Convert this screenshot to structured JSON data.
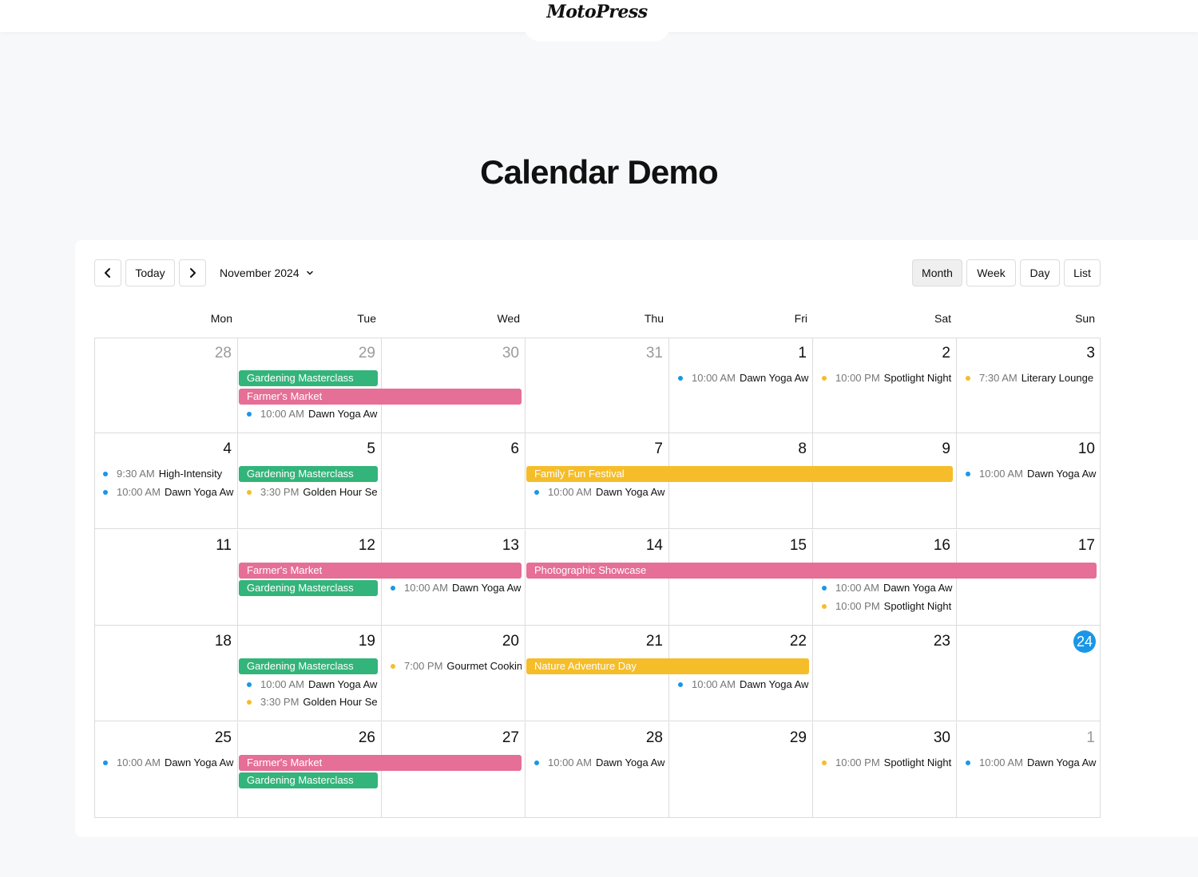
{
  "header": {
    "logo": "MotoPress"
  },
  "page": {
    "title": "Calendar Demo"
  },
  "toolbar": {
    "prev_icon": "chevron-left-icon",
    "today_label": "Today",
    "next_icon": "chevron-right-icon",
    "month_label": "November 2024",
    "views": [
      "Month",
      "Week",
      "Day",
      "List"
    ],
    "active_view": "Month"
  },
  "colors": {
    "green": "#33b47a",
    "pink": "#e56f96",
    "yellow": "#f5bd2a",
    "blue_dot": "#1a96e8",
    "yellow_dot": "#f5bd2a",
    "today": "#1a96e8"
  },
  "calendar": {
    "weekdays": [
      "Mon",
      "Tue",
      "Wed",
      "Thu",
      "Fri",
      "Sat",
      "Sun"
    ],
    "weeks": [
      [
        {
          "day": "28",
          "other": true
        },
        {
          "day": "29",
          "other": true
        },
        {
          "day": "30",
          "other": true
        },
        {
          "day": "31",
          "other": true
        },
        {
          "day": "1"
        },
        {
          "day": "2"
        },
        {
          "day": "3"
        }
      ],
      [
        {
          "day": "4"
        },
        {
          "day": "5"
        },
        {
          "day": "6"
        },
        {
          "day": "7"
        },
        {
          "day": "8"
        },
        {
          "day": "9"
        },
        {
          "day": "10"
        }
      ],
      [
        {
          "day": "11"
        },
        {
          "day": "12"
        },
        {
          "day": "13"
        },
        {
          "day": "14"
        },
        {
          "day": "15"
        },
        {
          "day": "16"
        },
        {
          "day": "17"
        }
      ],
      [
        {
          "day": "18"
        },
        {
          "day": "19"
        },
        {
          "day": "20"
        },
        {
          "day": "21"
        },
        {
          "day": "22"
        },
        {
          "day": "23"
        },
        {
          "day": "24",
          "today": true
        }
      ],
      [
        {
          "day": "25"
        },
        {
          "day": "26"
        },
        {
          "day": "27"
        },
        {
          "day": "28"
        },
        {
          "day": "29"
        },
        {
          "day": "30"
        },
        {
          "day": "1",
          "other": true
        }
      ]
    ],
    "bars": [
      {
        "week": 0,
        "start": 1,
        "span": 1,
        "slot": 0,
        "title": "Gardening Masterclass",
        "color": "green"
      },
      {
        "week": 0,
        "start": 1,
        "span": 2,
        "slot": 1,
        "title": "Farmer's Market",
        "color": "pink"
      },
      {
        "week": 1,
        "start": 1,
        "span": 1,
        "slot": 0,
        "title": "Gardening Masterclass",
        "color": "green"
      },
      {
        "week": 1,
        "start": 3,
        "span": 3,
        "slot": 0,
        "title": "Family Fun Festival",
        "color": "yellow"
      },
      {
        "week": 2,
        "start": 1,
        "span": 2,
        "slot": 0,
        "title": "Farmer's Market",
        "color": "pink"
      },
      {
        "week": 2,
        "start": 1,
        "span": 1,
        "slot": 1,
        "title": "Gardening Masterclass",
        "color": "green"
      },
      {
        "week": 2,
        "start": 3,
        "span": 4,
        "slot": 0,
        "title": "Photographic Showcase",
        "color": "pink"
      },
      {
        "week": 3,
        "start": 1,
        "span": 1,
        "slot": 0,
        "title": "Gardening Masterclass",
        "color": "green"
      },
      {
        "week": 3,
        "start": 3,
        "span": 2,
        "slot": 0,
        "title": "Nature Adventure Day",
        "color": "yellow"
      },
      {
        "week": 4,
        "start": 1,
        "span": 2,
        "slot": 0,
        "title": "Farmer's Market",
        "color": "pink"
      },
      {
        "week": 4,
        "start": 1,
        "span": 1,
        "slot": 1,
        "title": "Gardening Masterclass",
        "color": "green"
      }
    ],
    "events": [
      {
        "week": 0,
        "col": 1,
        "slot": 2,
        "time": "10:00 AM",
        "title": "Dawn Yoga Awakening",
        "dot": "blue_dot"
      },
      {
        "week": 0,
        "col": 4,
        "slot": 0,
        "time": "10:00 AM",
        "title": "Dawn Yoga Awakening",
        "dot": "blue_dot"
      },
      {
        "week": 0,
        "col": 5,
        "slot": 0,
        "time": "10:00 PM",
        "title": "Spotlight Night",
        "dot": "yellow_dot"
      },
      {
        "week": 0,
        "col": 6,
        "slot": 0,
        "time": "7:30 AM",
        "title": "Literary Lounge",
        "dot": "yellow_dot"
      },
      {
        "week": 1,
        "col": 0,
        "slot": 0,
        "time": "9:30 AM",
        "title": "High-Intensity",
        "dot": "blue_dot"
      },
      {
        "week": 1,
        "col": 0,
        "slot": 1,
        "time": "10:00 AM",
        "title": "Dawn Yoga Awakening",
        "dot": "blue_dot"
      },
      {
        "week": 1,
        "col": 1,
        "slot": 1,
        "time": "3:30 PM",
        "title": "Golden Hour Session",
        "dot": "yellow_dot"
      },
      {
        "week": 1,
        "col": 3,
        "slot": 1,
        "time": "10:00 AM",
        "title": "Dawn Yoga Awakening",
        "dot": "blue_dot"
      },
      {
        "week": 1,
        "col": 6,
        "slot": 0,
        "time": "10:00 AM",
        "title": "Dawn Yoga Awakening",
        "dot": "blue_dot"
      },
      {
        "week": 2,
        "col": 2,
        "slot": 1,
        "time": "10:00 AM",
        "title": "Dawn Yoga Awakening",
        "dot": "blue_dot"
      },
      {
        "week": 2,
        "col": 5,
        "slot": 1,
        "time": "10:00 AM",
        "title": "Dawn Yoga Awakening",
        "dot": "blue_dot"
      },
      {
        "week": 2,
        "col": 5,
        "slot": 2,
        "time": "10:00 PM",
        "title": "Spotlight Night",
        "dot": "yellow_dot"
      },
      {
        "week": 3,
        "col": 1,
        "slot": 1,
        "time": "10:00 AM",
        "title": "Dawn Yoga Awakening",
        "dot": "blue_dot"
      },
      {
        "week": 3,
        "col": 1,
        "slot": 2,
        "time": "3:30 PM",
        "title": "Golden Hour Session",
        "dot": "yellow_dot"
      },
      {
        "week": 3,
        "col": 2,
        "slot": 0,
        "time": "7:00 PM",
        "title": "Gourmet Cooking",
        "dot": "yellow_dot"
      },
      {
        "week": 3,
        "col": 4,
        "slot": 1,
        "time": "10:00 AM",
        "title": "Dawn Yoga Awakening",
        "dot": "blue_dot"
      },
      {
        "week": 4,
        "col": 0,
        "slot": 0,
        "time": "10:00 AM",
        "title": "Dawn Yoga Awakening",
        "dot": "blue_dot"
      },
      {
        "week": 4,
        "col": 3,
        "slot": 0,
        "time": "10:00 AM",
        "title": "Dawn Yoga Awakening",
        "dot": "blue_dot"
      },
      {
        "week": 4,
        "col": 5,
        "slot": 0,
        "time": "10:00 PM",
        "title": "Spotlight Night",
        "dot": "yellow_dot"
      },
      {
        "week": 4,
        "col": 6,
        "slot": 0,
        "time": "10:00 AM",
        "title": "Dawn Yoga Awakening",
        "dot": "blue_dot"
      }
    ]
  }
}
